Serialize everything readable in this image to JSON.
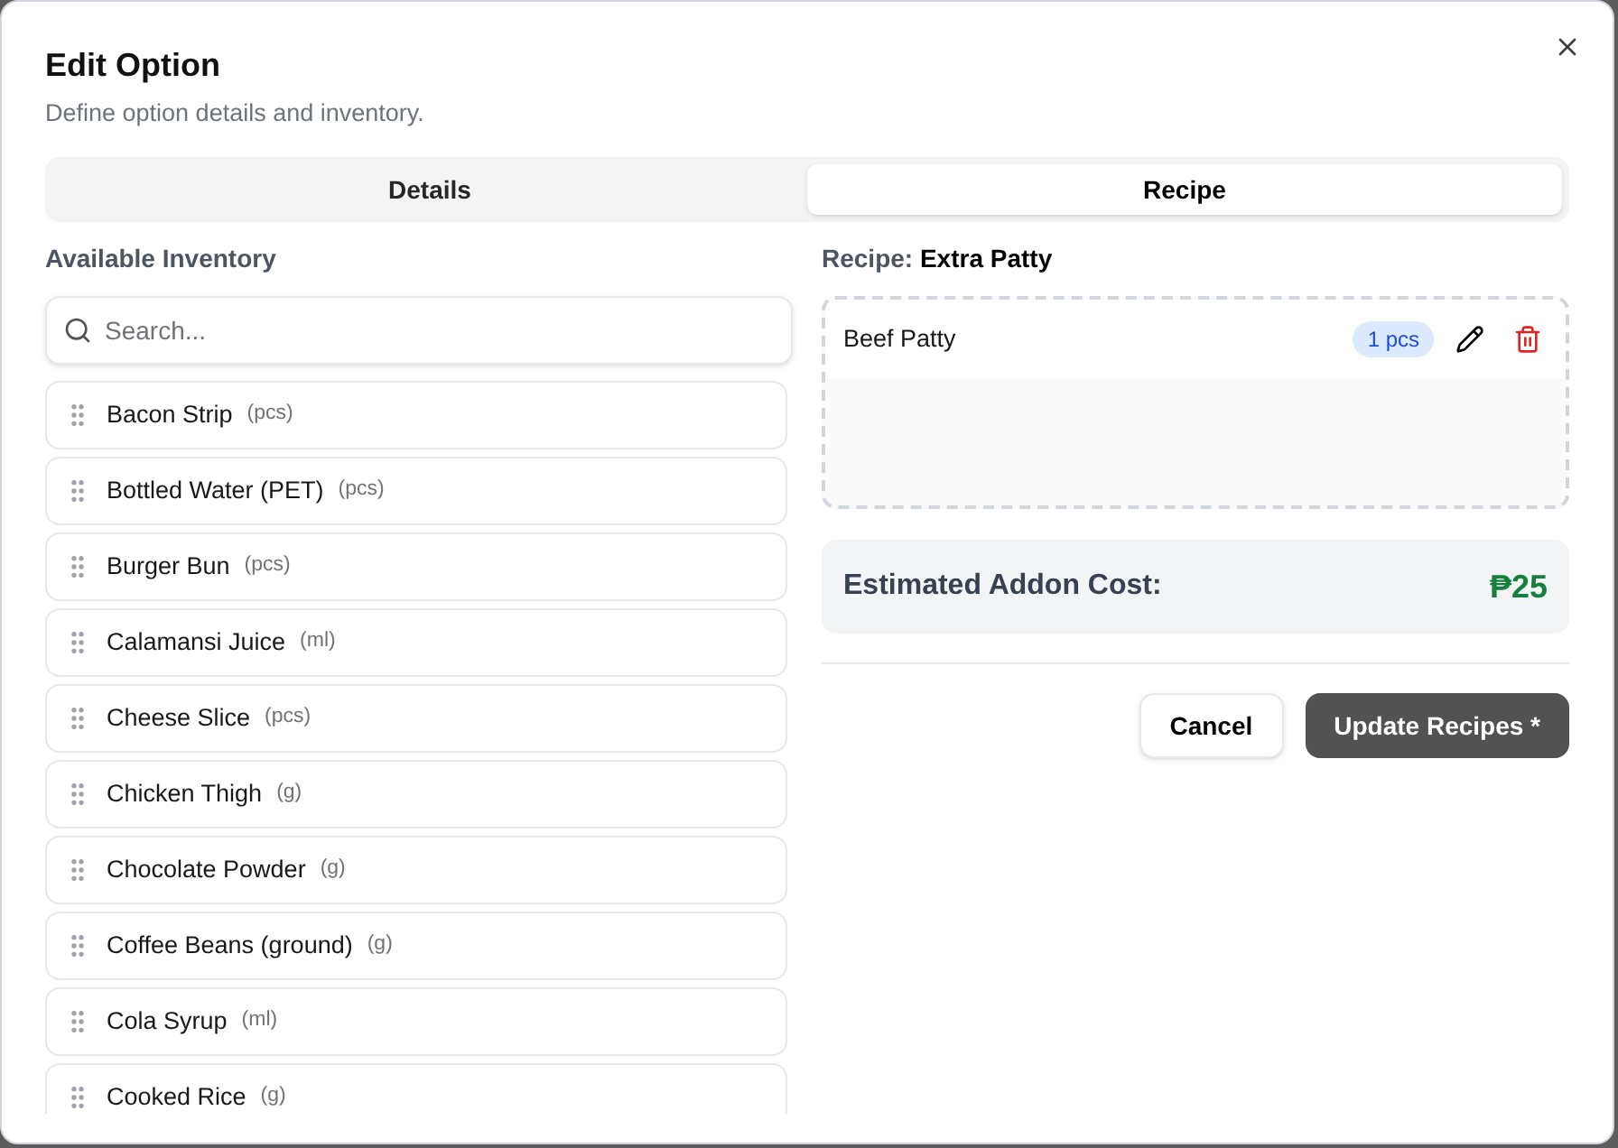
{
  "dialog": {
    "title": "Edit Option",
    "subtitle": "Define option details and inventory."
  },
  "tabs": [
    {
      "label": "Details",
      "selected": false
    },
    {
      "label": "Recipe",
      "selected": true
    }
  ],
  "inventory": {
    "heading": "Available Inventory",
    "search": {
      "placeholder": "Search..."
    },
    "items": [
      {
        "name": "Bacon Strip",
        "unit": "(pcs)"
      },
      {
        "name": "Bottled Water (PET)",
        "unit": "(pcs)"
      },
      {
        "name": "Burger Bun",
        "unit": "(pcs)"
      },
      {
        "name": "Calamansi Juice",
        "unit": "(ml)"
      },
      {
        "name": "Cheese Slice",
        "unit": "(pcs)"
      },
      {
        "name": "Chicken Thigh",
        "unit": "(g)"
      },
      {
        "name": "Chocolate Powder",
        "unit": "(g)"
      },
      {
        "name": "Coffee Beans (ground)",
        "unit": "(g)"
      },
      {
        "name": "Cola Syrup",
        "unit": "(ml)"
      },
      {
        "name": "Cooked Rice",
        "unit": "(g)"
      }
    ]
  },
  "recipe": {
    "title": "Recipe: **Extra Patty**",
    "ingredients": [
      {
        "name": "Beef Patty",
        "quantity": "1 pcs"
      }
    ]
  },
  "cost": {
    "label": "Estimated Addon Cost:",
    "value": "₱25"
  },
  "buttons": [
    {
      "label": "Cancel",
      "kind": "secondary"
    },
    {
      "label": "Update Recipes *",
      "kind": "primary"
    }
  ]
}
